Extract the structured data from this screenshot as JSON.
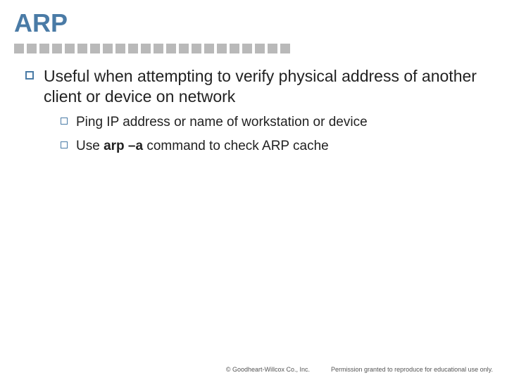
{
  "title": "ARP",
  "main_bullet": {
    "text": "Useful when attempting to verify physical address of another client or device on network"
  },
  "sub_bullets": [
    {
      "text": "Ping IP address or name of workstation or device"
    },
    {
      "prefix": "Use ",
      "bold": "arp –a",
      "suffix": " command to check ARP cache"
    }
  ],
  "footer": {
    "copyright": "© Goodheart-Willcox Co., Inc.",
    "permission": "Permission granted to reproduce for educational use only."
  },
  "separator_count": 22
}
